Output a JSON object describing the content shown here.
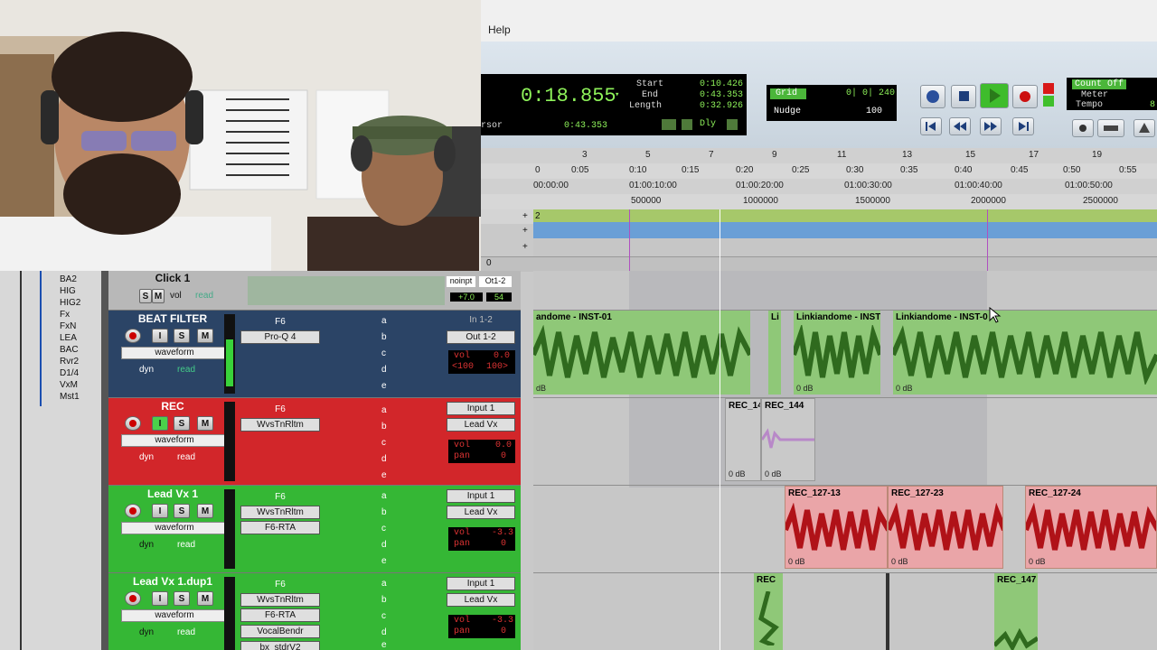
{
  "menu": {
    "help": "Help"
  },
  "transport": {
    "main_counter": "0:18.855",
    "start_label": "Start",
    "start": "0:10.426",
    "end_label": "End",
    "end": "0:43.353",
    "length_label": "Length",
    "length": "0:32.926",
    "cursor_label": "rsor",
    "cursor": "0:43.353",
    "dly": "Dly",
    "grid_label": "Grid",
    "grid_value": "0| 0| 240",
    "nudge_label": "Nudge",
    "nudge_value": "100",
    "count_off": "Count Off",
    "meter": "Meter",
    "tempo": "Tempo",
    "tempo_digit": "8"
  },
  "rulers": {
    "bars": [
      "3",
      "5",
      "7",
      "9",
      "11",
      "13",
      "15",
      "17",
      "19"
    ],
    "minsecs": [
      "0",
      "0:05",
      "0:10",
      "0:15",
      "0:20",
      "0:25",
      "0:30",
      "0:35",
      "0:40",
      "0:45",
      "0:50",
      "0:55"
    ],
    "timecode": [
      "00:00:00",
      "01:00:10:00",
      "01:00:20:00",
      "01:00:30:00",
      "01:00:40:00",
      "01:00:50:00"
    ],
    "samples": [
      "500000",
      "1000000",
      "1500000",
      "2000000",
      "2500000"
    ],
    "marker_num": "2",
    "zero_label": "0"
  },
  "tracklist": [
    "BA2",
    "HIG",
    "HIG2",
    "Fx",
    "FxN",
    "LEA",
    "BAC",
    "Rvr2",
    "D1/4",
    "VxM",
    "Mst1"
  ],
  "tracks": [
    {
      "name": "Click 1",
      "mode_vol": "vol",
      "mode_read": "read",
      "io_in": "noinpt",
      "io_out": "Ot1-2",
      "vol": "+7.0",
      "pan": "54"
    },
    {
      "name": "BEAT FILTER",
      "waveform": "waveform",
      "dyn": "dyn",
      "read": "read",
      "inserts": [
        "F6",
        "Pro-Q 4"
      ],
      "sends": [
        "a",
        "b",
        "c",
        "d",
        "e"
      ],
      "io_in": "In 1-2",
      "io_out": "Out 1-2",
      "vol_label": "vol",
      "vol": "0.0",
      "pan_l": "<100",
      "pan_r": "100>"
    },
    {
      "name": "REC",
      "waveform": "waveform",
      "dyn": "dyn",
      "read": "read",
      "inserts": [
        "F6",
        "WvsTnRltm"
      ],
      "sends": [
        "a",
        "b",
        "c",
        "d",
        "e"
      ],
      "io_in": "Input 1",
      "io_out": "Lead Vx",
      "vol_label": "vol",
      "vol": "0.0",
      "pan_label": "pan",
      "pan": "0"
    },
    {
      "name": "Lead Vx 1",
      "waveform": "waveform",
      "dyn": "dyn",
      "read": "read",
      "inserts": [
        "F6",
        "WvsTnRltm",
        "F6-RTA"
      ],
      "sends": [
        "a",
        "b",
        "c",
        "d",
        "e"
      ],
      "io_in": "Input 1",
      "io_out": "Lead Vx",
      "vol_label": "vol",
      "vol": "-3.3",
      "pan_label": "pan",
      "pan": "0"
    },
    {
      "name": "Lead Vx 1.dup1",
      "waveform": "waveform",
      "dyn": "dyn",
      "read": "read",
      "inserts": [
        "F6",
        "WvsTnRltm",
        "F6-RTA",
        "VocalBendr",
        "bx_stdrV2"
      ],
      "sends": [
        "a",
        "b",
        "c",
        "d",
        "e"
      ],
      "io_in": "Input 1",
      "io_out": "Lead Vx",
      "vol_label": "vol",
      "vol": "-3.3",
      "pan_label": "pan",
      "pan": "0"
    }
  ],
  "msr": {
    "mute": "M",
    "solo": "S",
    "input": "I"
  },
  "clips": {
    "beat": [
      "andome - INST-01",
      "Li",
      "Linkiandome - INST",
      "Linkiandome - INST-0"
    ],
    "beat_db": [
      "dB",
      "0 dB",
      "0 dB"
    ],
    "rec": [
      "REC_14",
      "REC_144"
    ],
    "rec_db": [
      "0 dB",
      "0 dB"
    ],
    "leadvx": [
      "REC_127-13",
      "REC_127-23",
      "REC_127-24"
    ],
    "leadvx_db": [
      "0 dB",
      "0 dB",
      "0 dB"
    ],
    "dup": [
      "REC",
      "REC_147"
    ]
  },
  "colors": {
    "beat_track": "#2b4466",
    "rec_track": "#d2262a",
    "leadvx_track": "#35b735",
    "wave_green": "#2f6a1e",
    "clip_green": "#8fc878",
    "clip_red": "#eaa5a8",
    "wave_red": "#b01218"
  }
}
